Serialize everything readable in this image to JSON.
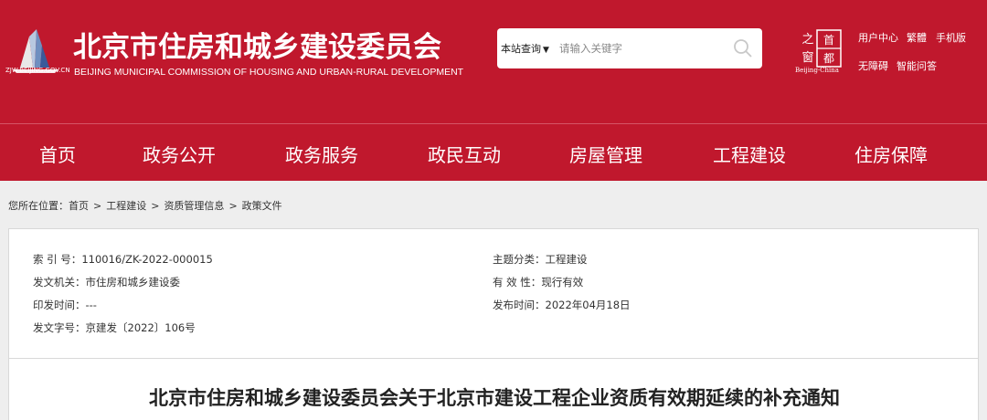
{
  "header": {
    "logo_domain": "ZJW.BEIJING.GOV.CN",
    "title": "北京市住房和城乡建设委员会",
    "subtitle": "BEIJING MUNICIPAL COMMISSION OF HOUSING AND URBAN-RURAL DEVELOPMENT",
    "search": {
      "scope": "本站查询",
      "placeholder": "请输入关键字"
    },
    "capital_logo_caption": "Beijing·China",
    "capital_logo_chars": [
      "之",
      "首",
      "窗",
      "都"
    ],
    "links": {
      "user_center": "用户中心",
      "traditional": "繁體",
      "mobile": "手机版",
      "accessibility": "无障碍",
      "smart_qa": "智能问答"
    },
    "colors": {
      "brand_red": "#c0182d"
    }
  },
  "nav": {
    "items": [
      {
        "label": "首页"
      },
      {
        "label": "政务公开"
      },
      {
        "label": "政务服务"
      },
      {
        "label": "政民互动"
      },
      {
        "label": "房屋管理"
      },
      {
        "label": "工程建设"
      },
      {
        "label": "住房保障"
      }
    ]
  },
  "breadcrumb": {
    "prefix": "您所在位置：",
    "items": [
      "首页",
      "工程建设",
      "资质管理信息",
      "政策文件"
    ],
    "separator": ">"
  },
  "info": {
    "index_no": {
      "label": "索 引 号：",
      "value": "110016/ZK-2022-000015"
    },
    "issuer": {
      "label": "发文机关：",
      "value": "市住房和城乡建设委"
    },
    "print_date": {
      "label": "印发时间：",
      "value": "---"
    },
    "doc_no": {
      "label": "发文字号：",
      "value": "京建发〔2022〕106号"
    },
    "topic": {
      "label": "主题分类：",
      "value": "工程建设"
    },
    "validity": {
      "label": "有 效 性：",
      "value": "现行有效"
    },
    "publish_date": {
      "label": "发布时间：",
      "value": "2022年04月18日"
    }
  },
  "article": {
    "title": "北京市住房和城乡建设委员会关于北京市建设工程企业资质有效期延续的补充通知"
  }
}
